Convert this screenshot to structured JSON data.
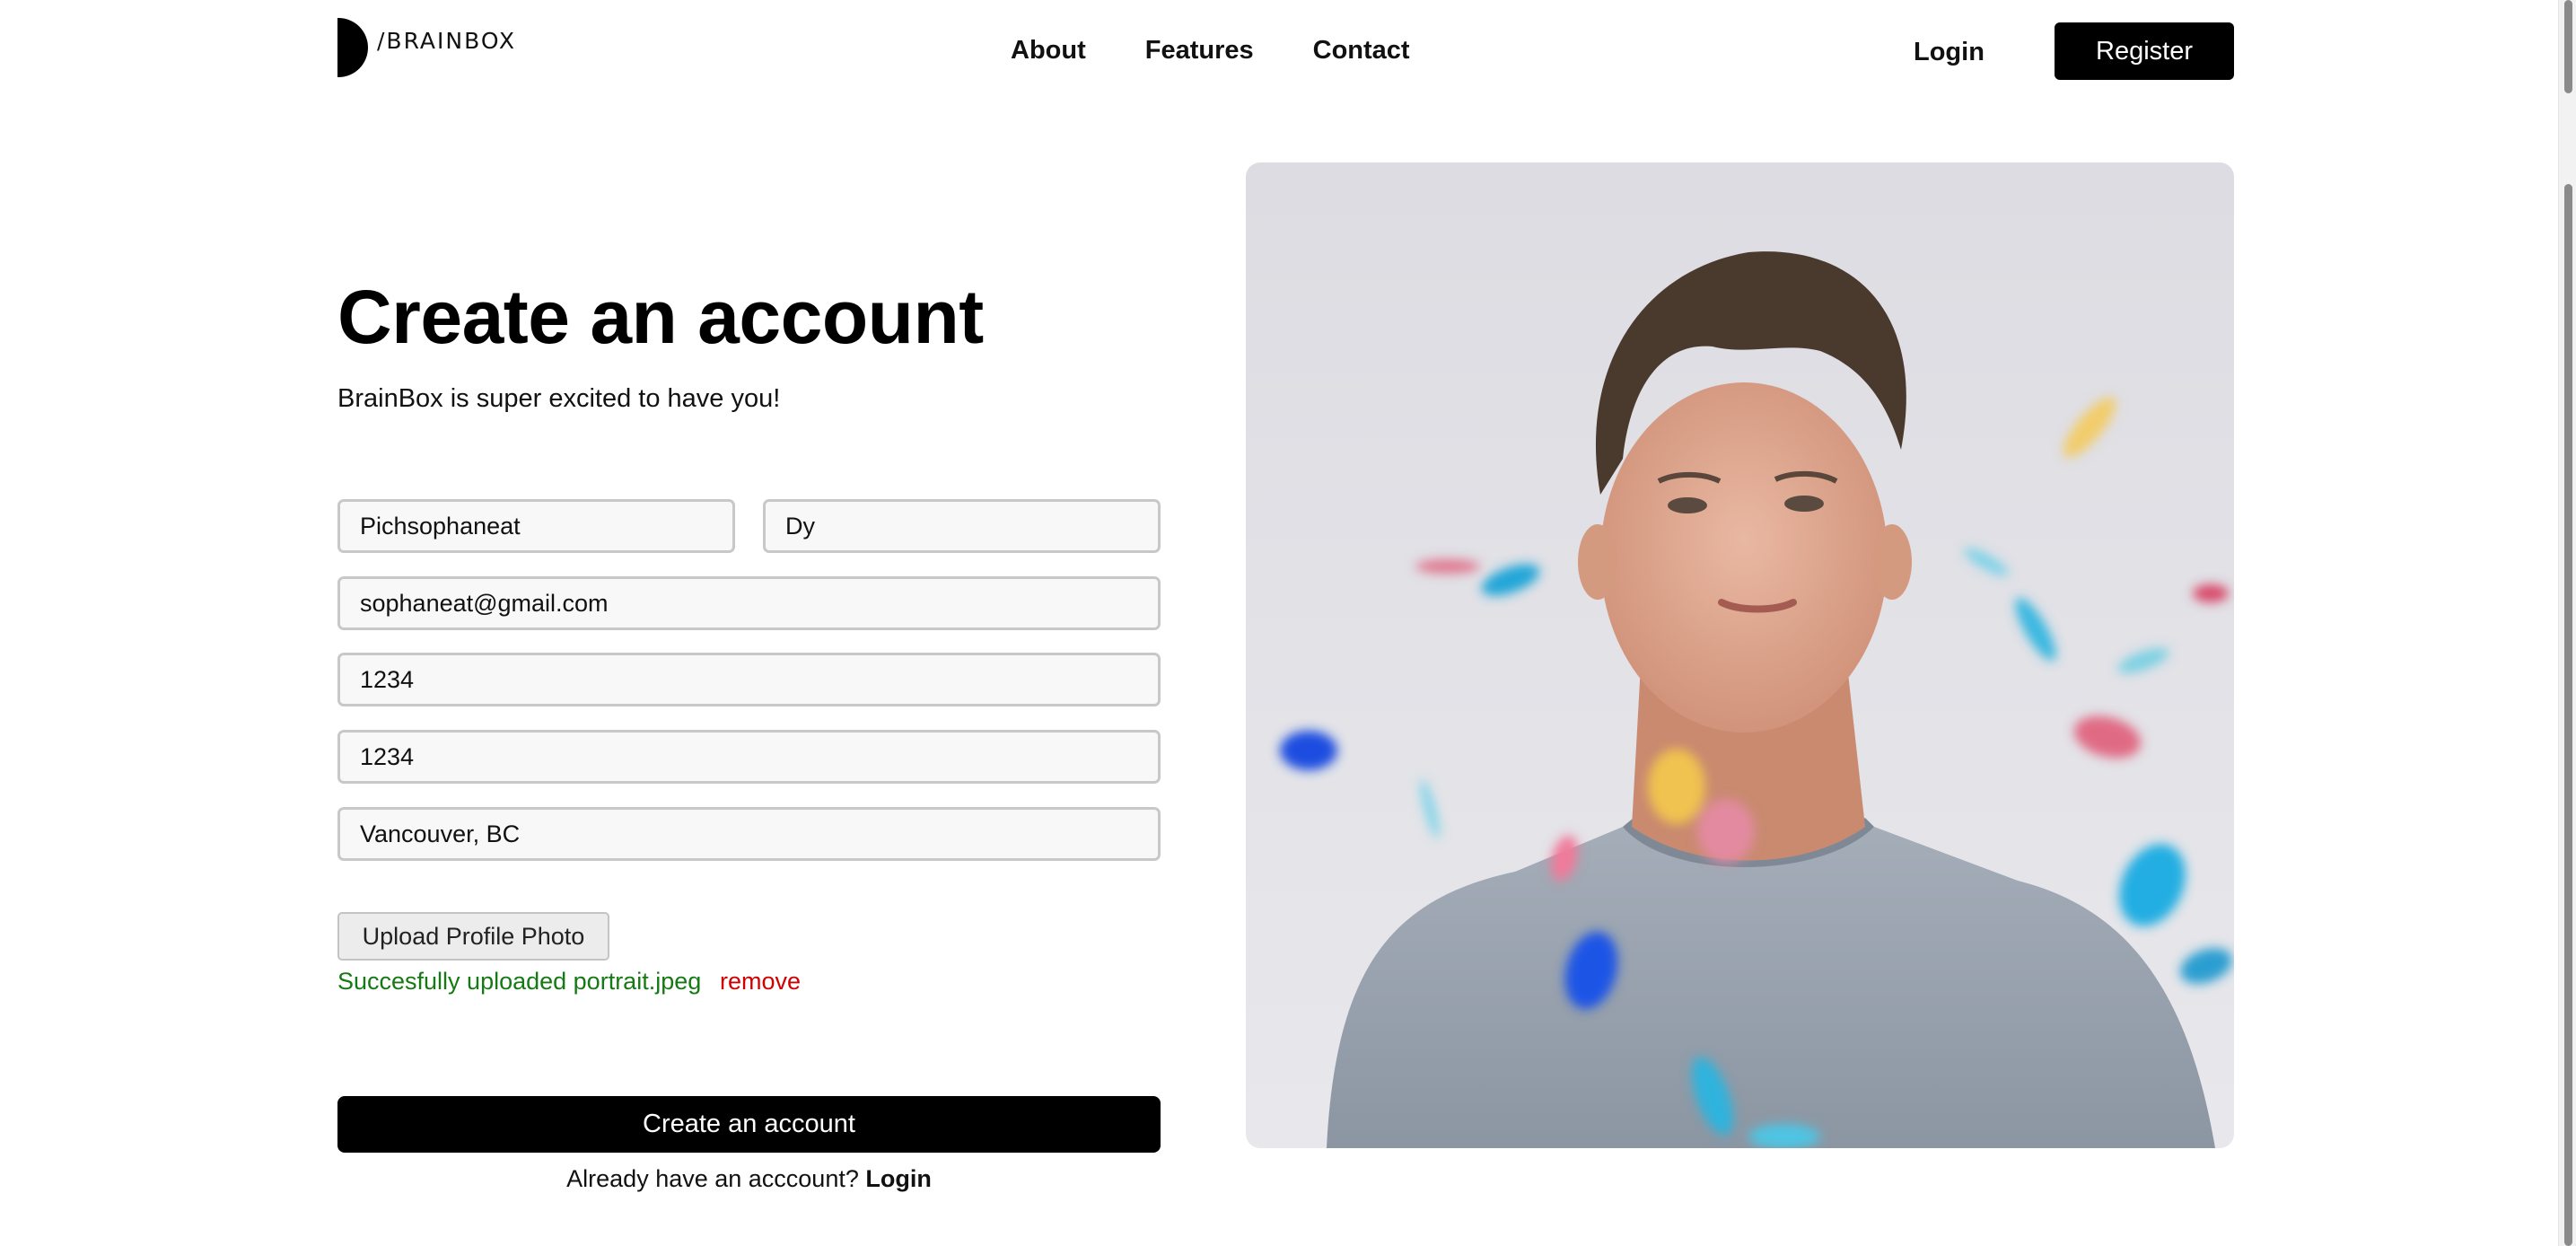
{
  "brand": {
    "name": "/BRAINBOX",
    "logo_icon": "half-circle-logo-icon"
  },
  "nav": {
    "items": [
      "About",
      "Features",
      "Contact"
    ]
  },
  "auth": {
    "login_label": "Login",
    "register_label": "Register"
  },
  "form": {
    "title": "Create an account",
    "subtitle": "BrainBox is super excited to have you!",
    "first_name": "Pichsophaneat",
    "last_name": "Dy",
    "email": "sophaneat@gmail.com",
    "password": "1234",
    "confirm_password": "1234",
    "location": "Vancouver, BC",
    "upload_label": "Upload Profile Photo",
    "upload_status": "Succesfully uploaded portrait.jpeg",
    "remove_label": "remove",
    "submit_label": "Create an account",
    "have_account_text": "Already have an acccount?",
    "have_account_link": "Login"
  },
  "colors": {
    "accent": "#000000",
    "success": "#157a13",
    "danger": "#d10000",
    "input_bg": "#f8f8f8",
    "input_border": "#c8c8c8"
  }
}
